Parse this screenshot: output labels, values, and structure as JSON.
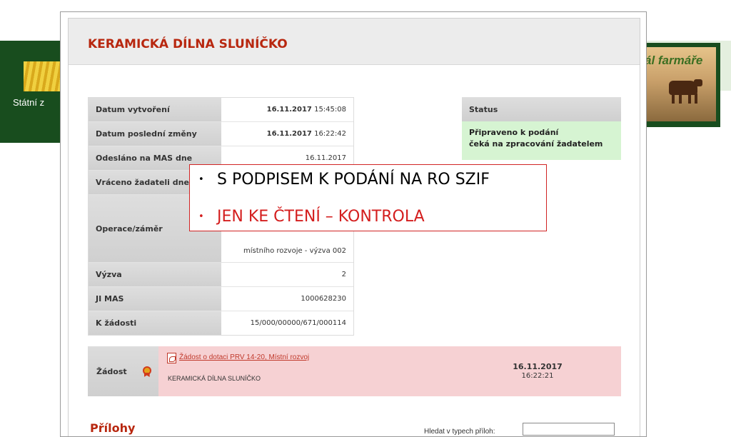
{
  "background": {
    "left_text": "Státní z",
    "right_text": "ál farmáře"
  },
  "modal": {
    "title": "KERAMICKÁ DÍLNA SLUNÍČKO"
  },
  "details": [
    {
      "label": "Datum vytvoření",
      "value_bold": "16.11.2017",
      "value": "15:45:08"
    },
    {
      "label": "Datum poslední změny",
      "value_bold": "16.11.2017",
      "value": "16:22:42"
    },
    {
      "label": "Odesláno na MAS dne",
      "value_bold": "",
      "value": "16.11.2017"
    },
    {
      "label": "Vráceno žadateli dne",
      "value_bold": "",
      "value": ""
    },
    {
      "label": "Operace/záměr",
      "value_bold": "",
      "value": "místního rozvoje - výzva 002"
    },
    {
      "label": "Výzva",
      "value_bold": "",
      "value": "2"
    },
    {
      "label": "JI MAS",
      "value_bold": "",
      "value": "1000628230"
    },
    {
      "label": "K žádosti",
      "value_bold": "",
      "value": "15/000/00000/671/000114"
    }
  ],
  "status": {
    "header": "Status",
    "line1": "Připraveno k podání",
    "line2": "čeká na zpracování žadatelem"
  },
  "callout": {
    "bullet": "•",
    "item1": "S PODPISEM K PODÁNÍ NA RO SZIF",
    "item2": "JEN KE ČTENÍ – KONTROLA",
    "item1_color": "#000000",
    "item2_color": "#d41e1e"
  },
  "zadost": {
    "label": "Žádost",
    "link": "Žádost o dotaci PRV 14-20, Místní rozvoj",
    "name": "KERAMICKÁ DÍLNA SLUNÍČKO",
    "date": "16.11.2017",
    "time": "16:22:21"
  },
  "prilohy": {
    "title": "Přílohy",
    "search_label": "Hledat v typech příloh:",
    "search_value": ""
  },
  "colors": {
    "accent_red": "#b8270f",
    "status_green": "#d6f4d2",
    "zadost_pink": "#f6d1d3"
  }
}
